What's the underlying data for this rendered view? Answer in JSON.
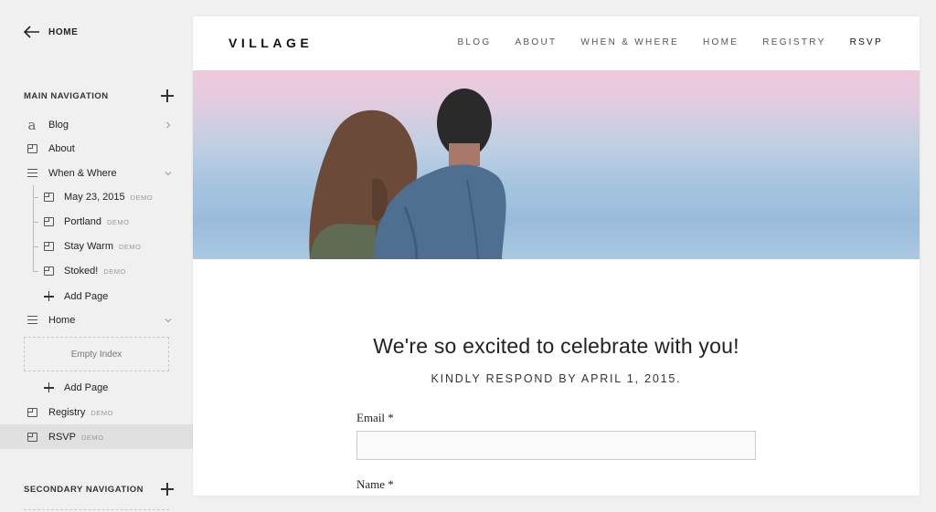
{
  "sidebar": {
    "back_label": "HOME",
    "main_nav_label": "MAIN NAVIGATION",
    "secondary_nav_label": "SECONDARY NAVIGATION",
    "items": [
      {
        "label": "Blog",
        "icon": "blog-icon"
      },
      {
        "label": "About",
        "icon": "page-icon"
      },
      {
        "label": "When & Where",
        "icon": "folder-icon"
      },
      {
        "label": "May 23, 2015",
        "badge": "DEMO",
        "icon": "page-icon"
      },
      {
        "label": "Portland",
        "badge": "DEMO",
        "icon": "page-icon"
      },
      {
        "label": "Stay Warm",
        "badge": "DEMO",
        "icon": "page-icon"
      },
      {
        "label": "Stoked!",
        "badge": "DEMO",
        "icon": "page-icon"
      },
      {
        "label": "Add Page",
        "icon": "plus-icon"
      },
      {
        "label": "Home",
        "icon": "index-icon"
      },
      {
        "label": "Add Page",
        "icon": "plus-icon"
      },
      {
        "label": "Registry",
        "badge": "DEMO",
        "icon": "page-icon"
      },
      {
        "label": "RSVP",
        "badge": "DEMO",
        "icon": "page-icon"
      }
    ],
    "empty_index_label": "Empty Index"
  },
  "site": {
    "logo": "VILLAGE",
    "nav": [
      "BLOG",
      "ABOUT",
      "WHEN & WHERE",
      "HOME",
      "REGISTRY",
      "RSVP"
    ],
    "headline": "We're so excited to celebrate with you!",
    "subline": "KINDLY RESPOND BY APRIL 1, 2015.",
    "email_label": "Email *",
    "email_value": "",
    "name_label": "Name *"
  },
  "colors": {
    "sidebar_bg": "#f0f0f0",
    "selected_bg": "#e0e0e0",
    "hero_pink": "#efc9de",
    "hero_blue": "#a4c3df"
  }
}
